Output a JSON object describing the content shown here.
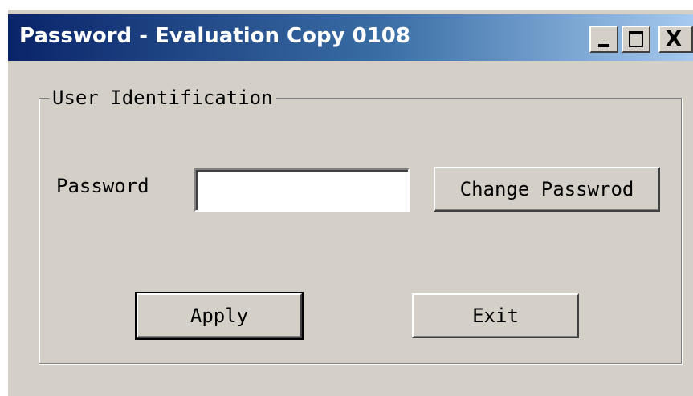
{
  "window": {
    "title": "Password - Evaluation Copy 0108",
    "controls": {
      "minimize_icon": "minimize-icon",
      "maximize_icon": "maximize-icon",
      "close_icon": "close-icon",
      "close_glyph": "X"
    }
  },
  "group": {
    "legend": "User Identification"
  },
  "password": {
    "label": "Password",
    "value": "",
    "placeholder": ""
  },
  "buttons": {
    "change_password": "Change Passwrod",
    "apply": "Apply",
    "exit": "Exit"
  }
}
